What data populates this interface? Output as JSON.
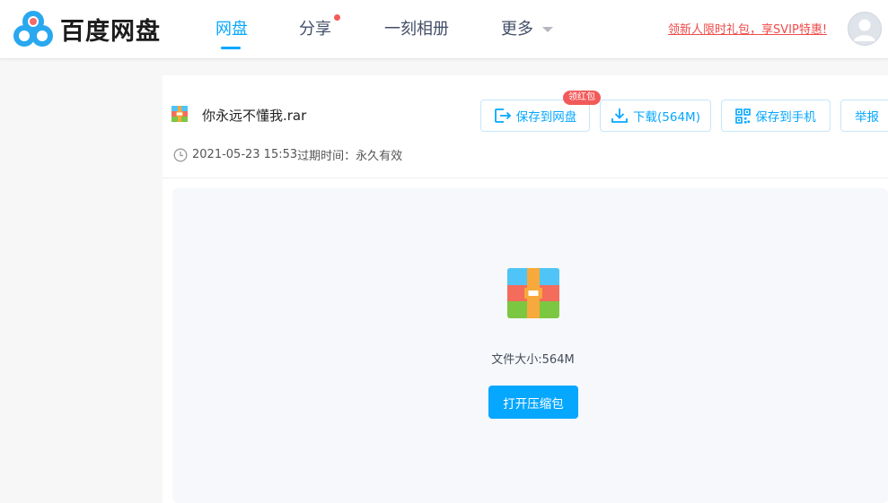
{
  "header": {
    "logo_text": "百度网盘",
    "nav": [
      {
        "label": "网盘",
        "active": true
      },
      {
        "label": "分享",
        "has_dot": true
      },
      {
        "label": "一刻相册"
      },
      {
        "label": "更多"
      }
    ],
    "promo_text": "领新人限时礼包，享SVIP特惠!",
    "accent_color": "#06a7ff",
    "dot_color": "#f25a5a"
  },
  "file": {
    "name": "你永远不懂我.rar",
    "share_date": "2021-05-23 15:53",
    "expire_label": "过期时间：",
    "expire_value": "永久有效",
    "size_label": "文件大小:564M"
  },
  "actions": {
    "save_to_disk": "保存到网盘",
    "save_badge": "领红包",
    "download": "下载(564M)",
    "save_to_phone": "保存到手机",
    "report": "举报"
  },
  "preview": {
    "open_archive": "打开压缩包"
  },
  "icons": {
    "logo": "baidu-netdisk-logo",
    "archive": "rar-archive-icon",
    "clock": "clock-icon",
    "save": "save-export-icon",
    "download": "download-icon",
    "qrcode": "qrcode-icon"
  }
}
